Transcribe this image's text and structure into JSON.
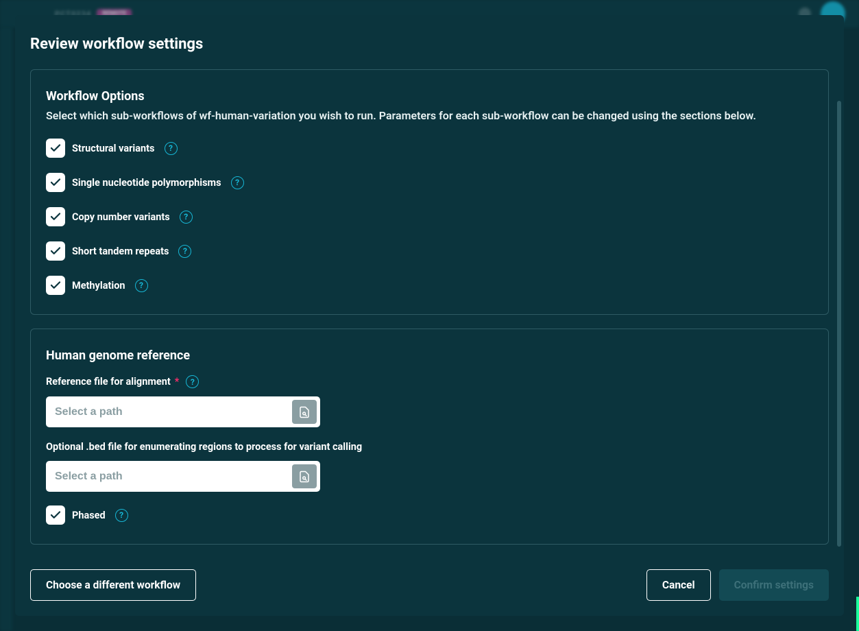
{
  "bg": {
    "label": "PCT0234",
    "badge": "REMOTE"
  },
  "modal": {
    "title": "Review workflow settings",
    "footer": {
      "choose": "Choose a different workflow",
      "cancel": "Cancel",
      "confirm": "Confirm settings"
    }
  },
  "workflow_options": {
    "title": "Workflow Options",
    "desc": "Select which sub-workflows of wf-human-variation you wish to run. Parameters for each sub-workflow can be changed using the sections below.",
    "items": {
      "sv": "Structural variants",
      "snp": "Single nucleotide polymorphisms",
      "cnv": "Copy number variants",
      "str": "Short tandem repeats",
      "meth": "Methylation"
    }
  },
  "genome_ref": {
    "title": "Human genome reference",
    "ref_label": "Reference file for alignment",
    "ref_placeholder": "Select a path",
    "bed_label": "Optional .bed file for enumerating regions to process for variant calling",
    "bed_placeholder": "Select a path",
    "phased_label": "Phased"
  }
}
